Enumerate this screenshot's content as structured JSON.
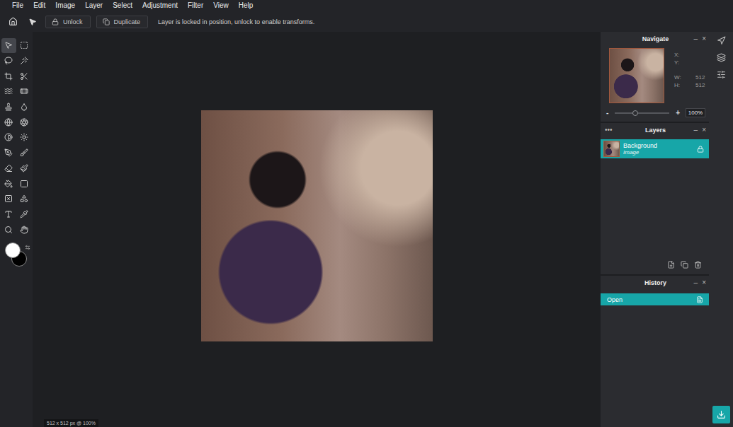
{
  "menu": [
    "File",
    "Edit",
    "Image",
    "Layer",
    "Select",
    "Adjustment",
    "Filter",
    "View",
    "Help"
  ],
  "toolbar": {
    "buttons": [
      {
        "label": "Unlock",
        "kind": "lock"
      },
      {
        "label": "Duplicate",
        "kind": "copy"
      }
    ],
    "message": "Layer is locked in position, unlock to enable transforms."
  },
  "tools": [
    {
      "kind": "move",
      "selected": true
    },
    {
      "kind": "marquee",
      "selected": false
    },
    {
      "kind": "lasso",
      "selected": false
    },
    {
      "kind": "wand",
      "selected": false
    },
    {
      "kind": "crop",
      "selected": false
    },
    {
      "kind": "slice",
      "selected": false
    },
    {
      "kind": "liquify",
      "selected": false
    },
    {
      "kind": "heal",
      "selected": false
    },
    {
      "kind": "stamp",
      "selected": false
    },
    {
      "kind": "blur",
      "selected": false
    },
    {
      "kind": "mesh",
      "selected": false
    },
    {
      "kind": "spot",
      "selected": false
    },
    {
      "kind": "dodge",
      "selected": false
    },
    {
      "kind": "sponge",
      "selected": false
    },
    {
      "kind": "pen",
      "selected": false
    },
    {
      "kind": "brush",
      "selected": false
    },
    {
      "kind": "eraser",
      "selected": false
    },
    {
      "kind": "pencil",
      "selected": false
    },
    {
      "kind": "fill",
      "selected": false
    },
    {
      "kind": "gradient",
      "selected": false
    },
    {
      "kind": "frame",
      "selected": false
    },
    {
      "kind": "shape",
      "selected": false
    },
    {
      "kind": "text",
      "selected": false
    },
    {
      "kind": "picker",
      "selected": false
    },
    {
      "kind": "zoom",
      "selected": false
    },
    {
      "kind": "hand",
      "selected": false
    }
  ],
  "colors": {
    "foreground": "#ffffff",
    "background": "#000000"
  },
  "navigate": {
    "title": "Navigate",
    "controls": [
      "–",
      "×"
    ],
    "x_label": "X:",
    "y_label": "Y:",
    "w_label": "W:",
    "w": "512",
    "h_label": "H:",
    "h": "512",
    "minus": "-",
    "plus": "+",
    "zoom": "100%",
    "zoom_level": 0.37
  },
  "layers": {
    "title": "Layers",
    "menu": "•••",
    "controls": [
      "–",
      "×"
    ],
    "items": [
      {
        "name": "Background",
        "type": "Image",
        "selected": true,
        "locked": true
      }
    ]
  },
  "history": {
    "title": "History",
    "controls": [
      "–",
      "×"
    ],
    "items": [
      {
        "label": "Open",
        "selected": true
      }
    ]
  },
  "status_bar": "512 x 512 px @ 100%"
}
